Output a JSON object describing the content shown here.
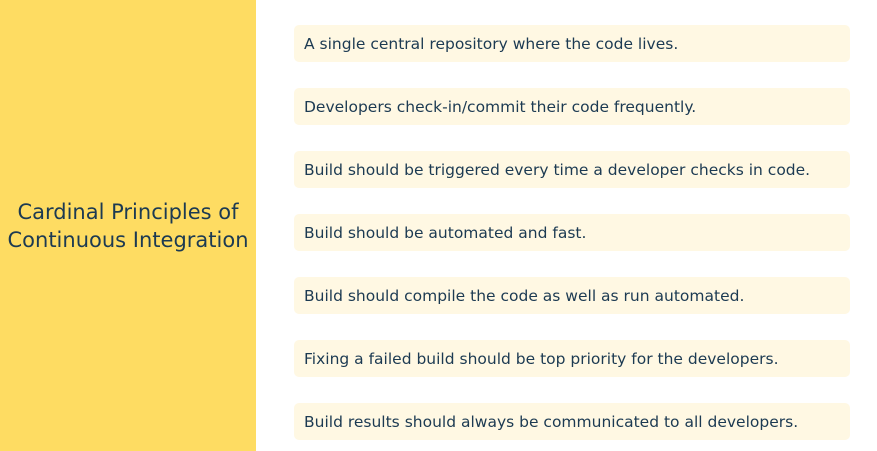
{
  "side_panel": {
    "title": "Cardinal Principles of\nContinuous Integration"
  },
  "principles": [
    "A single central repository where the code lives.",
    "Developers check-in/commit their code frequently.",
    "Build should be triggered every time a developer checks in code.",
    "Build should be automated and fast.",
    "Build should compile the code as well as run automated.",
    "Fixing a failed build should be top priority for the developers.",
    "Build results should always be communicated to all developers."
  ],
  "colors": {
    "panel_background": "#fedc62",
    "item_background": "#fff8e3",
    "text": "#1c3a52"
  }
}
